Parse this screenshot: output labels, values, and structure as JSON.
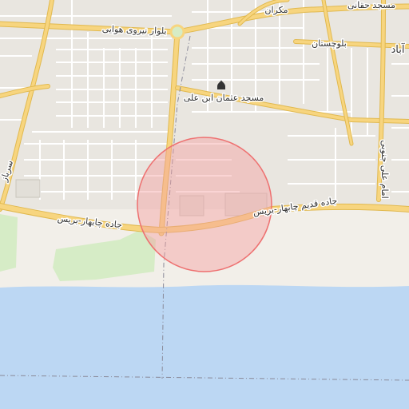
{
  "map": {
    "colors": {
      "land": "#f2efe9",
      "urban": "#e8e5df",
      "sea": "#bcd7f3",
      "green": "#d6ecc6",
      "beach": "#f5f2ec",
      "major_road": "#f7d57f",
      "major_road_casing": "#e1b94f",
      "minor_road": "#ffffff",
      "street_casing": "#d4d0c8",
      "boundary": "#8a8a99",
      "highlight_fill": "#f5a0a0",
      "highlight_stroke": "#ee7070"
    },
    "labels": {
      "street_hawai": "بلوار نیروی هوایی",
      "street_makran": "مکران",
      "mosque_haqqani": "مسجد حقانی",
      "street_baluchestan": "بلوچستان",
      "place_abad": "آباد",
      "mosque_uthman": "مسجد عثمان ابن علی",
      "street_imam_ali": "امام علی جنوبی",
      "street_sarbaz": "سرباز",
      "road_chabahar_east": "جاده قدیم چابهار-بریس",
      "road_chabahar_west": "جاده چابهار-بریس"
    },
    "icons": {
      "mosque": "mosque-icon"
    }
  }
}
